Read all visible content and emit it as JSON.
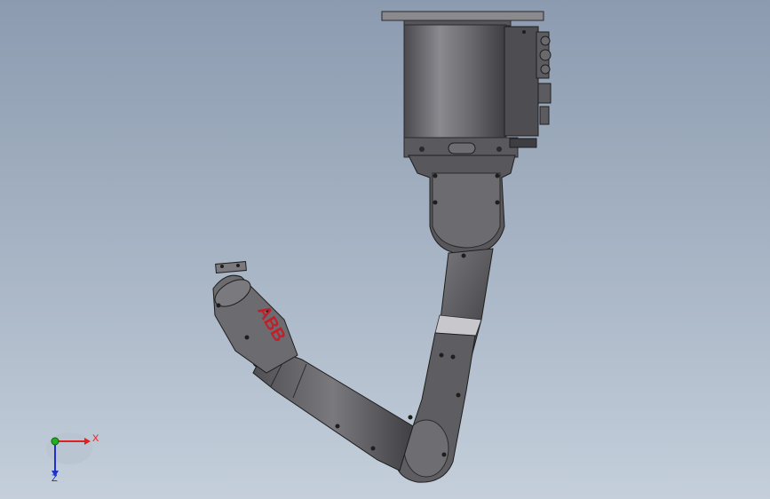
{
  "viewport": {
    "background_top": "#8c9bb0",
    "background_bottom": "#c4cfdb"
  },
  "model": {
    "logo_text": "ABB",
    "logo_color": "#c0202a",
    "body_color": "#6e6e72"
  },
  "triad": {
    "x_label": "X",
    "z_label": "Z",
    "x_color": "#e02020",
    "y_color": "#20b020",
    "z_color": "#2030d0"
  }
}
